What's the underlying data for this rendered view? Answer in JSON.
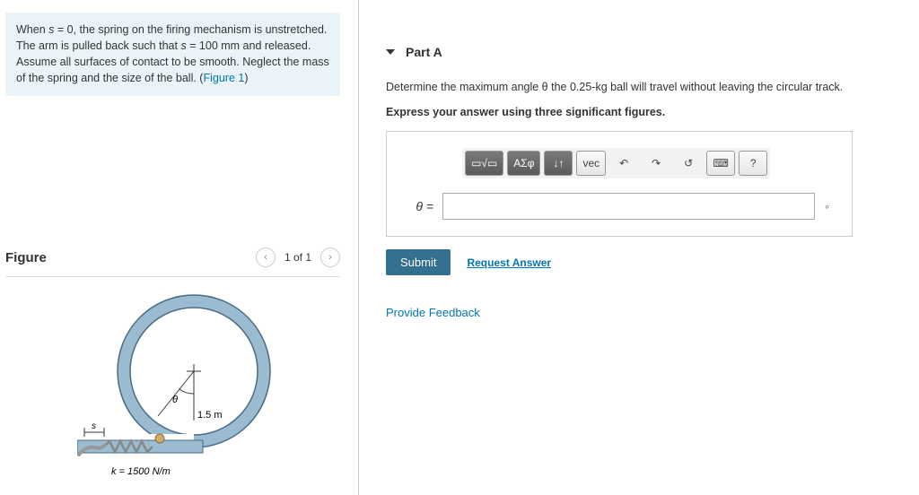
{
  "problem": {
    "text_p1": "When ",
    "var_s": "s",
    "eq0": " = 0, the spring on the firing mechanism is unstretched. The arm is pulled back such that ",
    "eq1": " = 100 mm and released. Assume all surfaces of contact to be smooth. Neglect the mass of the spring and the size of the ball. (",
    "fig_link": "Figure 1",
    "close": ")"
  },
  "figure": {
    "title": "Figure",
    "pager": "1 of 1",
    "radius": "1.5 m",
    "spring": "k = 1500 N/m",
    "label_s": "s",
    "label_theta": "θ"
  },
  "part": {
    "title": "Part A",
    "question": "Determine the maximum angle θ the 0.25-kg ball will travel without leaving the circular track.",
    "instructions": "Express your answer using three significant figures.",
    "toolbar": {
      "templates": "▭√▭",
      "greek": "ΑΣφ",
      "updown": "↓↑",
      "vec": "vec",
      "undo": "↶",
      "redo": "↷",
      "reset": "↺",
      "keyboard": "⌨",
      "help": "?"
    },
    "var_label": "θ =",
    "unit": "∘",
    "submit": "Submit",
    "request": "Request Answer"
  },
  "feedback": "Provide Feedback"
}
